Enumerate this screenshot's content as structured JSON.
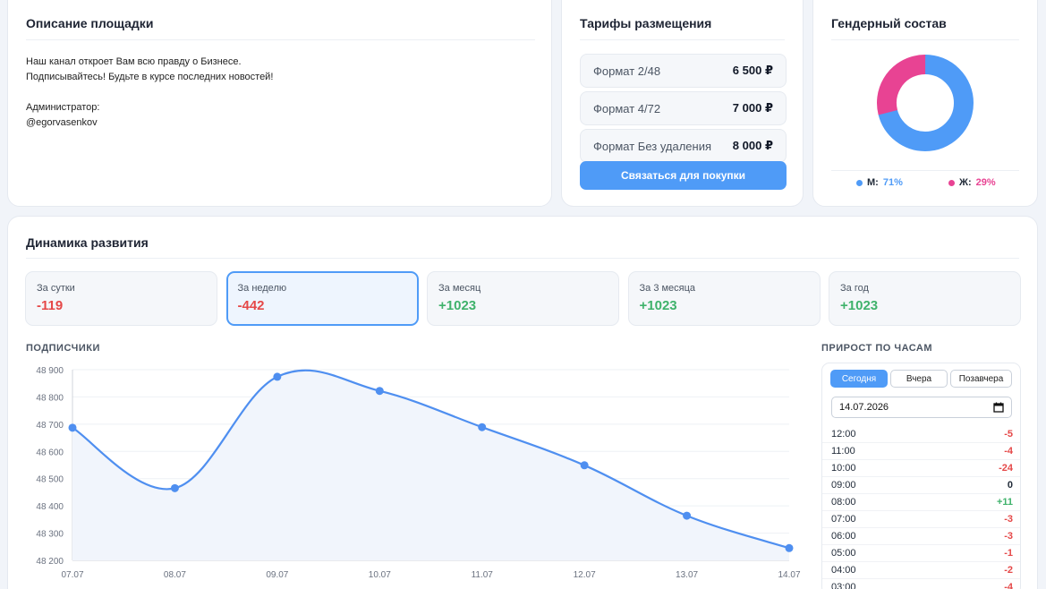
{
  "description": {
    "title": "Описание площадки",
    "line1": "Наш канал откроет Вам всю правду о Бизнесе.",
    "line2": "Подписывайтесь! Будьте в курсе последних новостей!",
    "admin_label": "Администратор:",
    "admin_handle": "@egorvasenkov"
  },
  "tariffs": {
    "title": "Тарифы размещения",
    "items": [
      {
        "name": "Формат 2/48",
        "price": "6 500 ₽"
      },
      {
        "name": "Формат 4/72",
        "price": "7 000 ₽"
      },
      {
        "name": "Формат Без удаления",
        "price": "8 000 ₽"
      }
    ],
    "button": "Связаться для покупки"
  },
  "gender": {
    "title": "Гендерный состав",
    "male_label": "М:",
    "male_value": "71%",
    "female_label": "Ж:",
    "female_value": "29%",
    "male_share": 0.71,
    "female_share": 0.29,
    "male_color": "#4f9bf7",
    "female_color": "#e84393"
  },
  "dynamics": {
    "title": "Динамика развития",
    "stats": [
      {
        "label": "За сутки",
        "value": "-119",
        "tone": "neg"
      },
      {
        "label": "За неделю",
        "value": "-442",
        "tone": "neg",
        "active": true
      },
      {
        "label": "За месяц",
        "value": "+1023",
        "tone": "pos"
      },
      {
        "label": "За 3 месяца",
        "value": "+1023",
        "tone": "pos"
      },
      {
        "label": "За год",
        "value": "+1023",
        "tone": "pos"
      }
    ],
    "subscribers_label": "ПОДПИСЧИКИ",
    "hourly_label": "ПРИРОСТ ПО ЧАСАМ"
  },
  "chart_data": {
    "type": "line",
    "x": [
      "07.07",
      "08.07",
      "09.07",
      "10.07",
      "11.07",
      "12.07",
      "13.07",
      "14.07"
    ],
    "values": [
      48687,
      48465,
      48874,
      48822,
      48689,
      48549,
      48364,
      48245
    ],
    "yticks": [
      "48 200",
      "48 300",
      "48 400",
      "48 500",
      "48 600",
      "48 700",
      "48 800",
      "48 900"
    ],
    "ylim": [
      48200,
      48900
    ],
    "grid": true,
    "line_color": "#4f8ff0"
  },
  "hourly": {
    "buttons": [
      "Сегодня",
      "Вчера",
      "Позавчера"
    ],
    "date": "14.07.2026",
    "rows": [
      {
        "hour": "12:00",
        "value": "-5",
        "tone": "neg"
      },
      {
        "hour": "11:00",
        "value": "-4",
        "tone": "neg"
      },
      {
        "hour": "10:00",
        "value": "-24",
        "tone": "neg"
      },
      {
        "hour": "09:00",
        "value": "0",
        "tone": "zero"
      },
      {
        "hour": "08:00",
        "value": "+11",
        "tone": "pos"
      },
      {
        "hour": "07:00",
        "value": "-3",
        "tone": "neg"
      },
      {
        "hour": "06:00",
        "value": "-3",
        "tone": "neg"
      },
      {
        "hour": "05:00",
        "value": "-1",
        "tone": "neg"
      },
      {
        "hour": "04:00",
        "value": "-2",
        "tone": "neg"
      },
      {
        "hour": "03:00",
        "value": "-4",
        "tone": "neg"
      }
    ]
  }
}
